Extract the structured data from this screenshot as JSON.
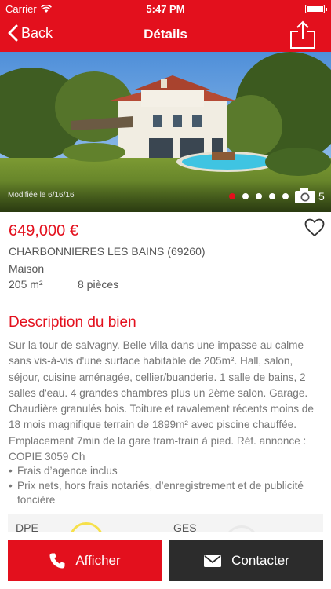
{
  "status_bar": {
    "carrier": "Carrier",
    "time": "5:47 PM"
  },
  "nav": {
    "back_label": "Back",
    "title": "Détails"
  },
  "gallery": {
    "modified": "Modifiée le 6/16/16",
    "photo_count": "5",
    "total_photos": 5,
    "current_index": 1
  },
  "listing": {
    "price": "649,000 €",
    "city": "CHARBONNIERES LES BAINS (69260)",
    "type": "Maison",
    "surface": "205 m²",
    "rooms": "8 pièces"
  },
  "description": {
    "title": "Description du bien",
    "text": "Sur la tour de salvagny. Belle villa dans une impasse au calme sans vis-à-vis d'une surface habitable de 205m². Hall, salon, séjour, cuisine aménagée, cellier/buanderie. 1 salle de bains, 2 salles d'eau. 4 grandes chambres plus un 2ème salon. Garage. Chaudière granulés bois. Toiture et ravalement récents moins de 18 mois magnifique terrain de 1899m² avec piscine chauffée. Emplacement 7min de la gare tram-train à pied. Réf. annonce : COPIE 3059 Ch"
  },
  "fees": [
    "Frais d’agence inclus",
    "Prix nets, hors frais notariés, d’enregistrement et de publicité foncière"
  ],
  "energy": {
    "dpe_label": "DPE",
    "ges_label": "GES"
  },
  "actions": {
    "call_label": "Afficher",
    "contact_label": "Contacter"
  },
  "colors": {
    "accent": "#e3101d",
    "dark_button": "#2c2c2c",
    "text": "#555555",
    "muted_text": "#777777"
  },
  "icons": [
    "wifi-icon",
    "battery-icon",
    "back-chevron-icon",
    "share-icon",
    "camera-icon",
    "heart-icon",
    "phone-icon",
    "mail-icon"
  ]
}
